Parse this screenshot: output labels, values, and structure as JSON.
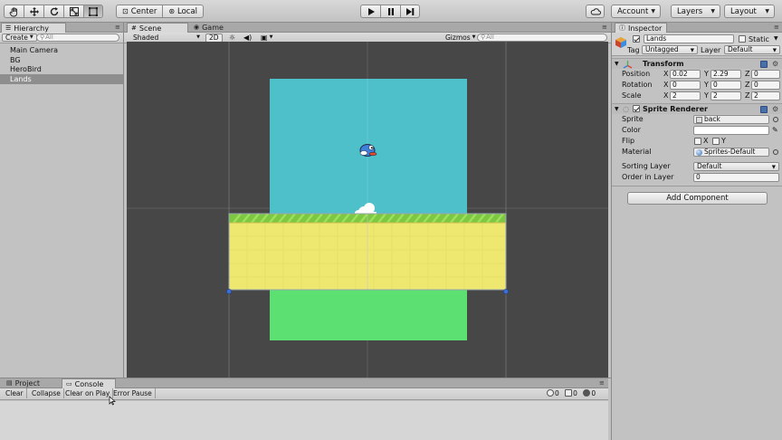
{
  "toolbar": {
    "tools": [
      "hand-icon",
      "move-icon",
      "rotate-icon",
      "scale-icon",
      "rect-icon"
    ],
    "pivot_center": "Center",
    "pivot_local": "Local",
    "account": "Account",
    "layers": "Layers",
    "layout": "Layout"
  },
  "hierarchy": {
    "tab": "Hierarchy",
    "create": "Create",
    "search_placeholder": "All",
    "items": [
      "Main Camera",
      "BG",
      "HeroBird",
      "Lands"
    ],
    "selected_index": 3
  },
  "scene": {
    "tab_scene": "Scene",
    "tab_game": "Game",
    "shading": "Shaded",
    "mode_2d": "2D",
    "gizmos": "Gizmos",
    "search_placeholder": "All",
    "colors": {
      "background": "#474747",
      "sky": "#4ec0ca",
      "ground_top": "#7cc843",
      "ground": "#eee770",
      "grass_bottom": "#5ce072"
    }
  },
  "inspector": {
    "tab": "Inspector",
    "object_name": "Lands",
    "static": "Static",
    "tag_label": "Tag",
    "tag_value": "Untagged",
    "layer_label": "Layer",
    "layer_value": "Default",
    "transform": {
      "title": "Transform",
      "position_label": "Position",
      "rotation_label": "Rotation",
      "scale_label": "Scale",
      "position": {
        "x": "0.02",
        "y": "2.29",
        "z": "0"
      },
      "rotation": {
        "x": "0",
        "y": "0",
        "z": "0"
      },
      "scale": {
        "x": "2",
        "y": "2",
        "z": "2"
      }
    },
    "sprite_renderer": {
      "title": "Sprite Renderer",
      "sprite_label": "Sprite",
      "sprite_value": "back",
      "color_label": "Color",
      "flip_label": "Flip",
      "flip_x": "X",
      "flip_y": "Y",
      "material_label": "Material",
      "material_value": "Sprites-Default",
      "sorting_layer_label": "Sorting Layer",
      "sorting_layer_value": "Default",
      "order_label": "Order in Layer",
      "order_value": "0"
    },
    "add_component": "Add Component"
  },
  "console": {
    "tab_project": "Project",
    "tab_console": "Console",
    "clear": "Clear",
    "collapse": "Collapse",
    "clear_on_play": "Clear on Play",
    "error_pause": "Error Pause",
    "info_count": "0",
    "warn_count": "0",
    "error_count": "0"
  }
}
